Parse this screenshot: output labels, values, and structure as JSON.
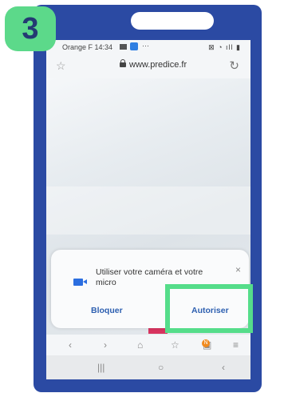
{
  "step": "3",
  "status": {
    "carrier_time": "Orange F 14:34",
    "dots": "···",
    "right_icons": "⊠ ◔ ıll ▮"
  },
  "browser": {
    "url": "www.predice.fr"
  },
  "dialog": {
    "message": "Utiliser votre caméra et votre micro",
    "close": "×",
    "block": "Bloquer",
    "allow": "Autoriser"
  },
  "nav": {
    "back": "‹",
    "forward": "›",
    "home": "⌂",
    "bookmark": "☆",
    "tabs": "▣",
    "menu": "≡",
    "badge": "N"
  },
  "system_nav": {
    "recents": "|||",
    "home": "○",
    "back": "‹"
  },
  "colors": {
    "frame": "#2b4aa3",
    "highlight": "#55dd8a",
    "accent": "#2d5fb0"
  }
}
